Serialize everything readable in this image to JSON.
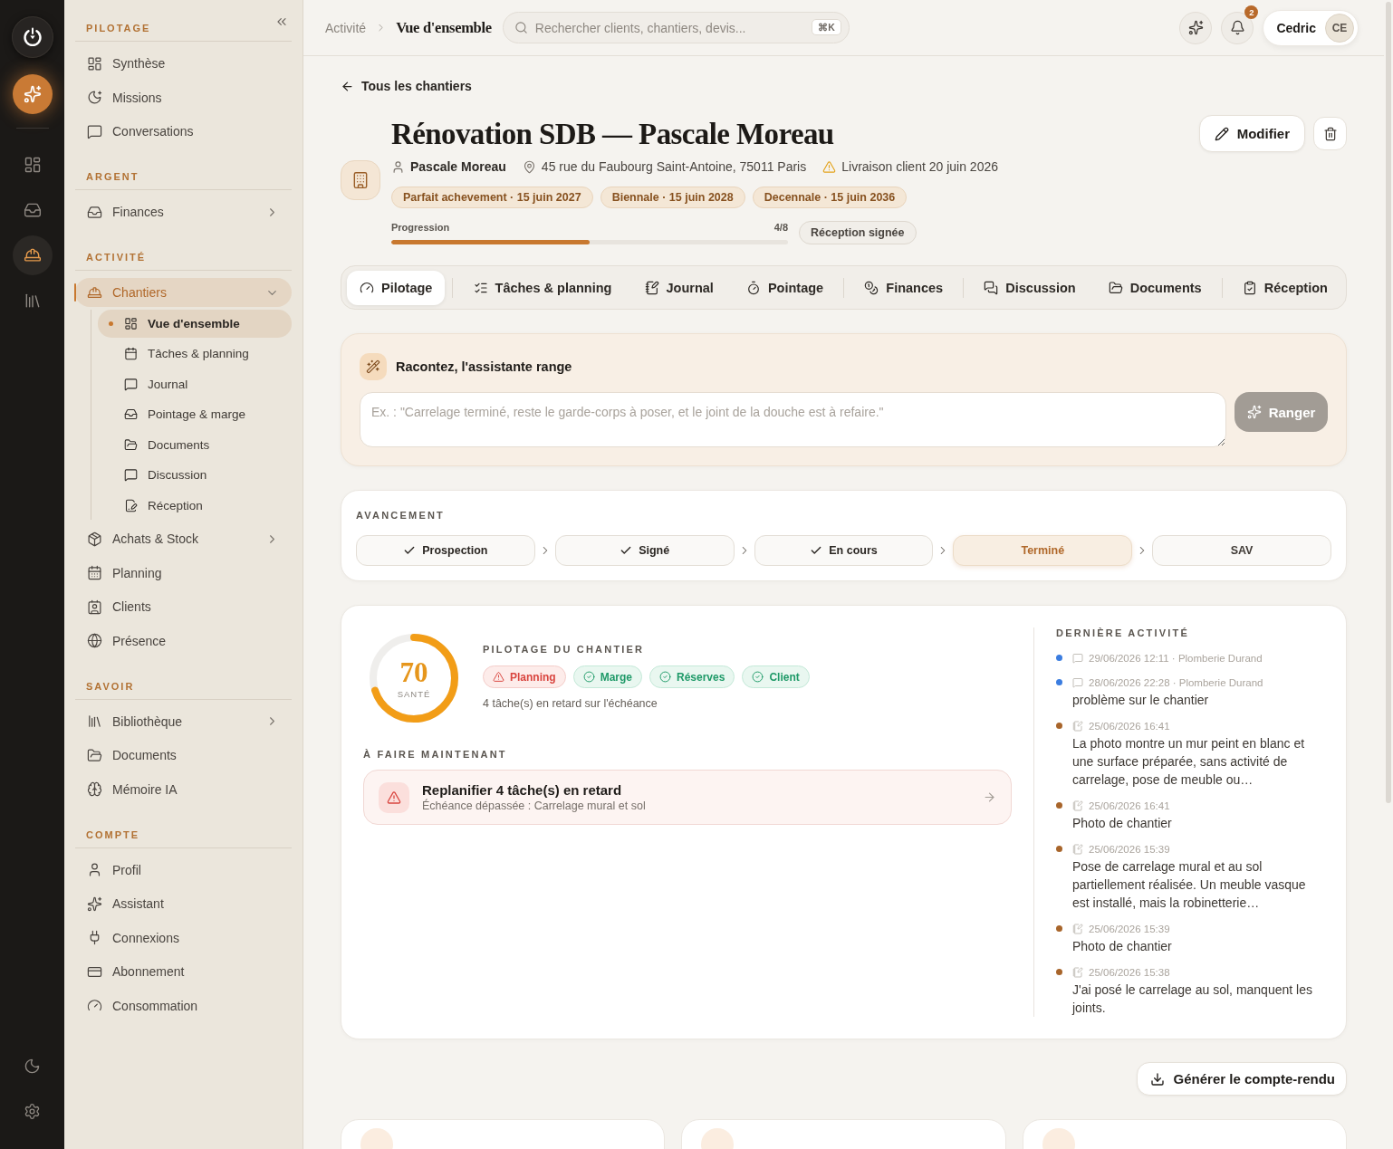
{
  "rail": {
    "items": [
      {
        "selected": false
      },
      {
        "selected": false
      },
      {
        "selected": true
      },
      {
        "selected": false
      }
    ]
  },
  "sidebar": {
    "sections": [
      {
        "title": "PILOTAGE",
        "items": [
          {
            "label": "Synthèse",
            "selected": false,
            "submenu": false
          },
          {
            "label": "Missions",
            "selected": false,
            "submenu": false
          },
          {
            "label": "Conversations",
            "selected": false,
            "submenu": false
          }
        ]
      },
      {
        "title": "ARGENT",
        "items": [
          {
            "label": "Finances",
            "selected": false,
            "submenu": true,
            "expanded": false
          }
        ]
      },
      {
        "title": "ACTIVITÉ",
        "items": [
          {
            "label": "Chantiers",
            "selected": true,
            "submenu": true,
            "expanded": true,
            "children": [
              {
                "label": "Vue d'ensemble",
                "selected": true
              },
              {
                "label": "Tâches & planning",
                "selected": false
              },
              {
                "label": "Journal",
                "selected": false
              },
              {
                "label": "Pointage & marge",
                "selected": false
              },
              {
                "label": "Documents",
                "selected": false
              },
              {
                "label": "Discussion",
                "selected": false
              },
              {
                "label": "Réception",
                "selected": false
              }
            ]
          },
          {
            "label": "Achats & Stock",
            "selected": false,
            "submenu": true,
            "expanded": false
          },
          {
            "label": "Planning",
            "selected": false,
            "submenu": false
          },
          {
            "label": "Clients",
            "selected": false,
            "submenu": false
          },
          {
            "label": "Présence",
            "selected": false,
            "submenu": false
          }
        ]
      },
      {
        "title": "SAVOIR",
        "items": [
          {
            "label": "Bibliothèque",
            "selected": false,
            "submenu": true,
            "expanded": false
          },
          {
            "label": "Documents",
            "selected": false,
            "submenu": false
          },
          {
            "label": "Mémoire IA",
            "selected": false,
            "submenu": false
          }
        ]
      },
      {
        "title": "COMPTE",
        "items": [
          {
            "label": "Profil",
            "selected": false,
            "submenu": false
          },
          {
            "label": "Assistant",
            "selected": false,
            "submenu": false
          },
          {
            "label": "Connexions",
            "selected": false,
            "submenu": false
          },
          {
            "label": "Abonnement",
            "selected": false,
            "submenu": false
          },
          {
            "label": "Consommation",
            "selected": false,
            "submenu": false
          }
        ]
      }
    ]
  },
  "topbar": {
    "breadcrumb": [
      {
        "label": "Activité",
        "current": false
      },
      {
        "label": "Vue d'ensemble",
        "current": true
      }
    ],
    "search": {
      "placeholder": "Rechercher clients, chantiers, devis...",
      "shortcut": "⌘K"
    },
    "notifications": {
      "count": "2"
    },
    "user": {
      "name": "Cedric",
      "initials": "CE"
    }
  },
  "page": {
    "back_link": "Tous les chantiers",
    "title": "Rénovation SDB — Pascale Moreau",
    "meta": [
      {
        "kind": "person",
        "text": "Pascale Moreau"
      },
      {
        "kind": "place",
        "text": "45 rue du Faubourg Saint-Antoine, 75011 Paris"
      },
      {
        "kind": "warning",
        "text": "Livraison client 20 juin 2026"
      }
    ],
    "warranties": [
      "Parfait achevement · 15 juin 2027",
      "Biennale · 15 juin 2028",
      "Decennale · 15 juin 2036"
    ],
    "progress": {
      "label": "Progression",
      "reading": "4/8",
      "level": 0.5
    },
    "status_tag": "Réception signée",
    "edit_button": "Modifier"
  },
  "tabs": {
    "groups": [
      {
        "tabs": [
          {
            "label": "Pilotage",
            "selected": true
          }
        ]
      },
      {
        "tabs": [
          {
            "label": "Tâches & planning",
            "selected": false
          },
          {
            "label": "Journal",
            "selected": false
          },
          {
            "label": "Pointage",
            "selected": false
          }
        ]
      },
      {
        "tabs": [
          {
            "label": "Finances",
            "selected": false
          }
        ]
      },
      {
        "tabs": [
          {
            "label": "Discussion",
            "selected": false
          },
          {
            "label": "Documents",
            "selected": false
          }
        ]
      },
      {
        "tabs": [
          {
            "label": "Réception",
            "selected": false
          }
        ]
      }
    ]
  },
  "assistant": {
    "title": "Racontez, l'assistante range",
    "placeholder": "Ex. : \"Carrelage terminé, reste le garde-corps à poser, et le joint de la douche est à refaire.\"",
    "button": {
      "label": "Ranger",
      "disabled": true
    }
  },
  "stages": {
    "title": "AVANCEMENT",
    "steps": [
      {
        "label": "Prospection",
        "done": true,
        "current": false
      },
      {
        "label": "Signé",
        "done": true,
        "current": false
      },
      {
        "label": "En cours",
        "done": true,
        "current": false
      },
      {
        "label": "Terminé",
        "done": false,
        "current": true
      },
      {
        "label": "SAV",
        "done": false,
        "current": false
      }
    ]
  },
  "health": {
    "score": "70",
    "score_label": "SANTÉ",
    "level": 0.7,
    "title": "PILOTAGE DU CHANTIER",
    "badges": [
      {
        "label": "Planning",
        "alert": true
      },
      {
        "label": "Marge",
        "alert": false
      },
      {
        "label": "Réserves",
        "alert": false
      },
      {
        "label": "Client",
        "alert": false
      }
    ],
    "summary": "4 tâche(s) en retard sur l'échéance",
    "todo_title": "À FAIRE MAINTENANT",
    "todo": [
      {
        "title": "Replanifier 4 tâche(s) en retard",
        "detail": "Échéance dépassée : Carrelage mural et sol"
      }
    ]
  },
  "activity": {
    "title": "DERNIÈRE ACTIVITÉ",
    "items": [
      {
        "kind": "message",
        "color": "#3b7de0",
        "meta": "29/06/2026 12:11 · Plomberie Durand"
      },
      {
        "kind": "message",
        "color": "#3b7de0",
        "meta": "28/06/2026 22:28 · Plomberie Durand",
        "text": "problème sur le chantier"
      },
      {
        "kind": "journal",
        "color": "#a8652b",
        "meta": "25/06/2026 16:41",
        "text": "La photo montre un mur peint en blanc et une surface préparée, sans activité de carrelage, pose de meuble ou…"
      },
      {
        "kind": "journal",
        "color": "#a8652b",
        "meta": "25/06/2026 16:41",
        "text": "Photo de chantier"
      },
      {
        "kind": "journal",
        "color": "#a8652b",
        "meta": "25/06/2026 15:39",
        "text": "Pose de carrelage mural et au sol partiellement réalisée. Un meuble vasque est installé, mais la robinetterie…"
      },
      {
        "kind": "journal",
        "color": "#a8652b",
        "meta": "25/06/2026 15:39",
        "text": "Photo de chantier"
      },
      {
        "kind": "journal",
        "color": "#a8652b",
        "meta": "25/06/2026 15:38",
        "text": "J'ai posé le carrelage au sol, manquent les joints."
      }
    ]
  },
  "report_button": "Générer le compte-rendu"
}
